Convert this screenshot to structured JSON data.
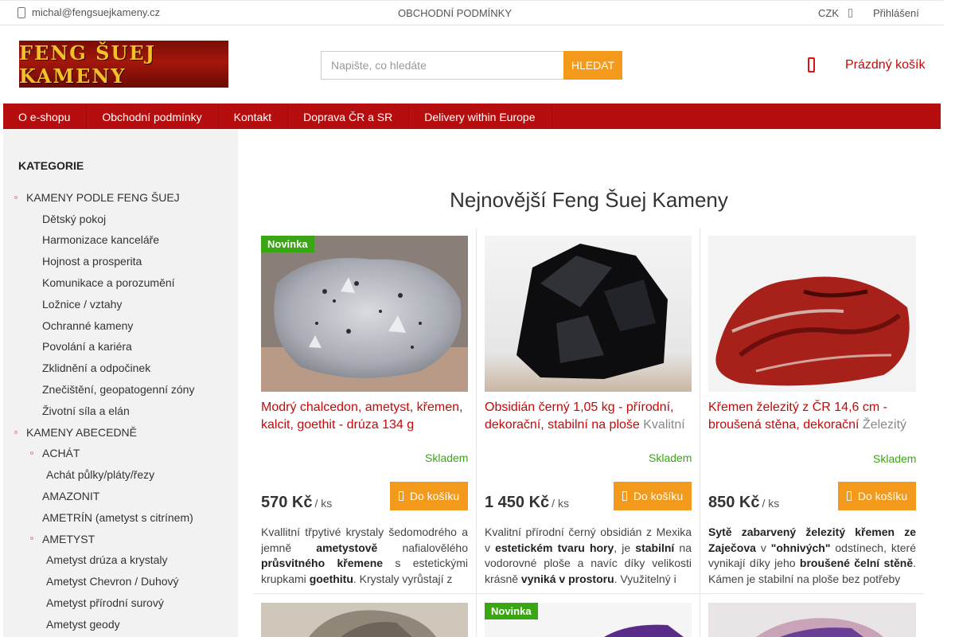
{
  "topbar": {
    "email": "michal@fengsuejkameny.cz",
    "terms": "OBCHODNÍ PODMÍNKY",
    "currency": "CZK",
    "login": "Přihlášení"
  },
  "header": {
    "logo_text": "FENG ŠUEJ KAMENY",
    "search_placeholder": "Napište, co hledáte",
    "search_button": "HLEDAT",
    "cart_label": "Prázdný košík"
  },
  "nav": [
    "O e-shopu",
    "Obchodní podmínky",
    "Kontakt",
    "Doprava ČR a SR",
    "Delivery within Europe"
  ],
  "sidebar": {
    "heading": "KATEGORIE",
    "categories": [
      "KAMENY PODLE FENG ŠUEJ",
      "Dětský pokoj",
      "Harmonizace kanceláře",
      "Hojnost a prosperita",
      "Komunikace a porozumění",
      "Ložnice / vztahy",
      "Ochranné kameny",
      "Povolání a kariéra",
      "Zklidnění a odpočinek",
      "Znečištění, geopatogenní zóny",
      "Životní síla a elán",
      "KAMENY ABECEDNĚ",
      "ACHÁT",
      "Achát půlky/pláty/řezy",
      "AMAZONIT",
      "AMETRÍN (ametyst s citrínem)",
      "AMETYST",
      "Ametyst drúza a krystaly",
      "Ametyst Chevron / Duhový",
      "Ametyst přírodní surový",
      "Ametyst geody"
    ]
  },
  "main": {
    "title": "Nejnovější Feng Šuej Kameny",
    "products": [
      {
        "badge": "Novinka",
        "title": "Modrý chalcedon, ametyst, křemen, kalcit, goethit - drúza 134 g",
        "subtitle": "",
        "stock": "Skladem",
        "price": "570 Kč",
        "unit": "/ ks",
        "buy": "Do košíku",
        "desc": [
          {
            "t": "Kvallitní třpytivé krystaly šedomodrého a jemně ",
            "b": false
          },
          {
            "t": "ametystově",
            "b": true
          },
          {
            "t": " nafialovělého ",
            "b": false
          },
          {
            "t": "průsvitného křemene",
            "b": true
          },
          {
            "t": " s estetickými krupkami ",
            "b": false
          },
          {
            "t": "goethitu",
            "b": true
          },
          {
            "t": ". Krystaly vyrůstají z",
            "b": false
          }
        ]
      },
      {
        "badge": "",
        "title": "Obsidián černý 1,05 kg - přírodní, dekorační, stabilní na ploše",
        "subtitle": "Kvalitní",
        "stock": "Skladem",
        "price": "1 450 Kč",
        "unit": "/ ks",
        "buy": "Do košíku",
        "desc": [
          {
            "t": "Kvalitní přírodní černý obsidián z Mexika v ",
            "b": false
          },
          {
            "t": "estetickém tvaru hory",
            "b": true
          },
          {
            "t": ", je ",
            "b": false
          },
          {
            "t": "stabilní",
            "b": true
          },
          {
            "t": " na vodorovné ploše a navíc díky velikosti krásně ",
            "b": false
          },
          {
            "t": "vyniká v prostoru",
            "b": true
          },
          {
            "t": ". Využitelný i",
            "b": false
          }
        ]
      },
      {
        "badge": "",
        "title": "Křemen železitý z ČR 14,6 cm - broušená stěna, dekorační",
        "subtitle": "Železitý",
        "stock": "Skladem",
        "price": "850 Kč",
        "unit": "/ ks",
        "buy": "Do košíku",
        "desc": [
          {
            "t": "Sytě zabarvený železitý křemen ze Zaječova",
            "b": true
          },
          {
            "t": " v ",
            "b": false
          },
          {
            "t": "\"ohnivých\"",
            "b": true
          },
          {
            "t": " odstínech, které vynikají díky jeho ",
            "b": false
          },
          {
            "t": "broušené čelní stěně",
            "b": true
          },
          {
            "t": ". Kámen je stabilní na ploše bez potřeby",
            "b": false
          }
        ]
      }
    ],
    "second_row_badge": "Novinka"
  }
}
